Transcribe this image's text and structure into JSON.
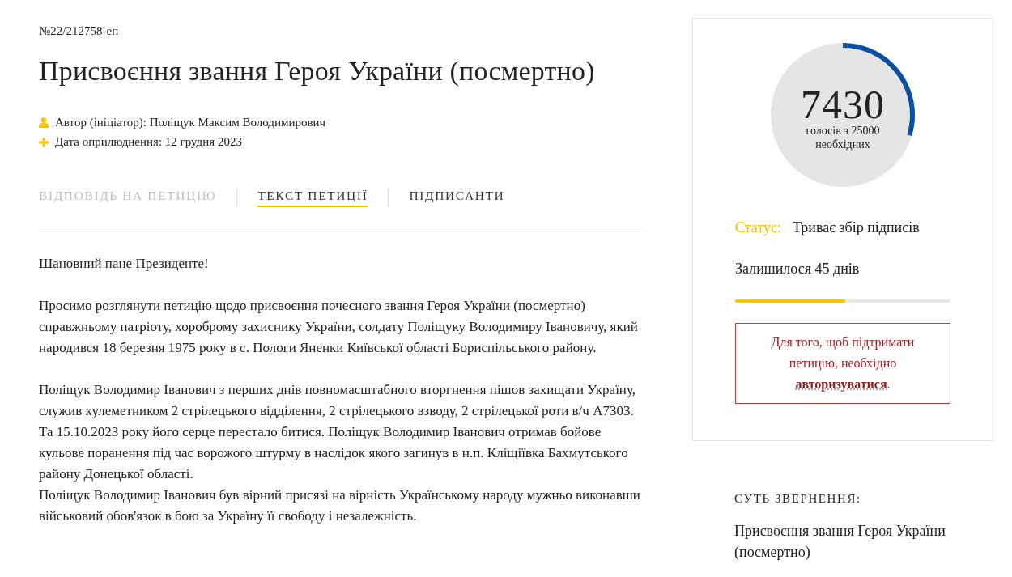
{
  "petition_number": "№22/212758-еп",
  "title": "Присвоєння звання Героя України (посмертно)",
  "meta": [
    {
      "kind": "author",
      "text": "Автор (ініціатор): Поліщук Максим Володимирович"
    },
    {
      "kind": "date",
      "text": "Дата оприлюднення: 12 грудня 2023"
    }
  ],
  "tabs": [
    {
      "label": "ВІДПОВІДЬ НА ПЕТИЦІЮ",
      "selected": false,
      "disabled": true
    },
    {
      "label": "ТЕКСТ ПЕТИЦІЇ",
      "selected": true,
      "disabled": false
    },
    {
      "label": "ПІДПИСАНТИ",
      "selected": false,
      "disabled": false
    }
  ],
  "sections": [
    [
      "Шановний пане Президенте!"
    ],
    [
      "Просимо розглянути петицію щодо присвоєння почесного звання Героя України (посмертно) справжньому патріоту, хороброму захиснику України, солдату Поліщуку Володимиру Івановичу, який народився 18 березня 1975 року в с. Пологи Яненки Київської області Бориспільського району."
    ],
    [
      "Поліщук Володимир Іванович з перших днів повномасштабного вторгнення пішов захищати Україну, служив кулеметником 2 стрілецького відділення, 2 стрілецького взводу, 2 стрілецької роти в/ч А7303. Та 15.10.2023 року його серце перестало битися. Поліщук Володимир Іванович отримав бойове кульове поранення під час ворожого штурму в наслідок якого загинув в н.п. Кліщіївка Бахмутського району Донецької області.",
      "Поліщук Володимир Іванович був вірний присязі на вірність Українському народу мужньо виконавши військовий обов'язок в бою за Україну її свободу і незалежність."
    ]
  ],
  "votes": {
    "count": "7430",
    "caption_1": "голосів з 25000",
    "caption_2": "необхідних"
  },
  "status": {
    "label": "Статус:",
    "value": "Триває збір підписів"
  },
  "remaining": {
    "text": "Залишилося 45 днів",
    "level": 0.51
  },
  "login_notice": {
    "text": "Для того, щоб підтримати петицію, необхідно",
    "link": "авторизуватися",
    "after": "."
  },
  "summary": {
    "heading": "СУТЬ ЗВЕРНЕННЯ:",
    "text": "Присвоєння звання Героя України (посмертно)"
  }
}
